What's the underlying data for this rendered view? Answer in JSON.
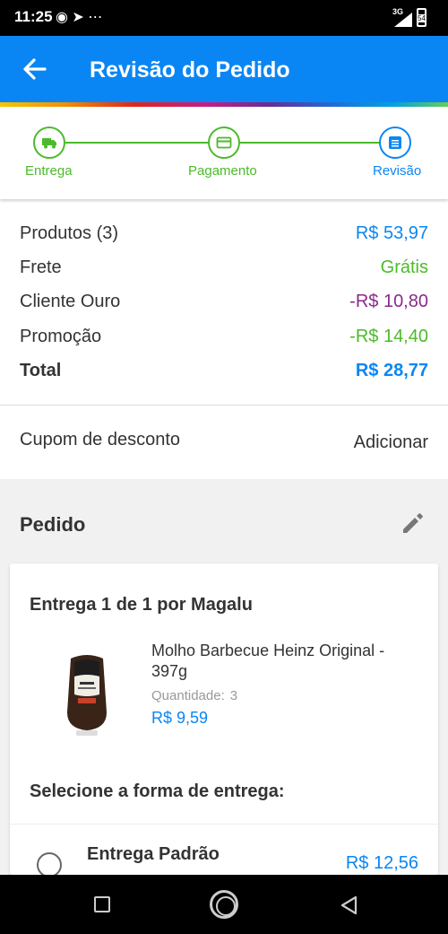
{
  "status_bar": {
    "time": "11:25",
    "notification_icons": [
      "facebook-icon",
      "telegram-icon",
      "more-icon"
    ],
    "network": "3G",
    "battery": "54"
  },
  "header": {
    "title": "Revisão do Pedido",
    "back_icon": "arrow-left-icon",
    "background": "#0a86f4"
  },
  "stepper": {
    "steps": [
      {
        "label": "Entrega",
        "icon": "truck-icon",
        "state": "complete"
      },
      {
        "label": "Pagamento",
        "icon": "credit-card-icon",
        "state": "complete"
      },
      {
        "label": "Revisão",
        "icon": "list-icon",
        "state": "active"
      }
    ],
    "complete_color": "#4cba2b",
    "active_color": "#0a86f4"
  },
  "summary": {
    "rows": [
      {
        "label": "Produtos (3)",
        "value": "R$ 53,97",
        "color": "#0a86f4"
      },
      {
        "label": "Frete",
        "value": "Grátis",
        "color": "#4cba2b"
      },
      {
        "label": "Cliente Ouro",
        "value": "-R$ 10,80",
        "color": "#8a2a8a"
      },
      {
        "label": "Promoção",
        "value": "-R$ 14,40",
        "color": "#4cba2b"
      }
    ],
    "total_label": "Total",
    "total_value": "R$ 28,77"
  },
  "coupon": {
    "label": "Cupom de desconto",
    "action": "Adicionar"
  },
  "order": {
    "title": "Pedido",
    "edit_icon": "pencil-icon",
    "delivery_heading": "Entrega 1 de 1 por Magalu",
    "product": {
      "name": "Molho Barbecue Heinz Original - 397g",
      "quantity_label": "Quantidade:",
      "quantity": "3",
      "price": "R$ 9,59"
    },
    "select_delivery_label": "Selecione a forma de entrega:",
    "delivery_option": {
      "label": "Entrega Padrão",
      "price": "R$ 12,56"
    }
  },
  "nav_bar": {
    "icons": [
      "recents-square-icon",
      "home-circle-icon",
      "back-triangle-icon"
    ]
  }
}
